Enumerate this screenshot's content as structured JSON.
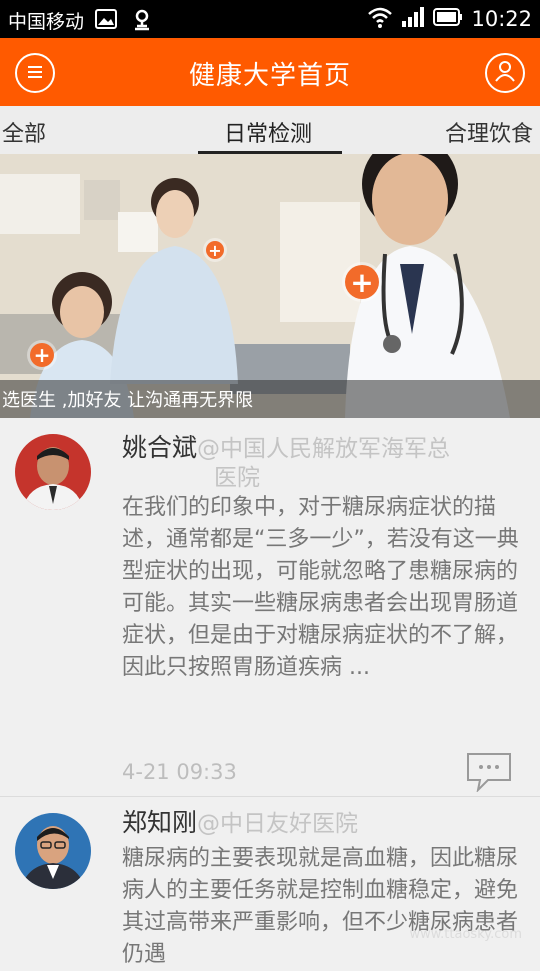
{
  "status_bar": {
    "carrier": "中国移动",
    "time": "10:22",
    "icons": [
      "image-icon",
      "location-pin-icon",
      "wifi-icon",
      "signal-icon",
      "battery-icon"
    ]
  },
  "app_bar": {
    "title": "健康大学首页",
    "left_icon": "menu-icon",
    "right_icon": "user-icon",
    "color": "#ff5a00"
  },
  "tabs": [
    {
      "label": "全部",
      "active": false
    },
    {
      "label": "日常检测",
      "active": true
    },
    {
      "label": "合理饮食",
      "active": false
    }
  ],
  "banner": {
    "caption": "选医生 ,加好友 让沟通再无界限"
  },
  "posts": [
    {
      "name": "姚合斌",
      "hospital_line1": "@中国人民解放军海军总",
      "hospital_line2": "医院",
      "body": "在我们的印象中，对于糖尿病症状的描述，通常都是“三多一少”，若没有这一典型症状的出现，可能就忽略了患糖尿病的可能。其实一些糖尿病患者会出现胃肠道症状，但是由于对糖尿病症状的不了解，因此只按照胃肠道疾病 ...",
      "time": "4-21 09:33"
    },
    {
      "name": "郑知刚",
      "hospital_line1": "@中日友好医院",
      "body": "糖尿病的主要表现就是高血糖，因此糖尿病人的主要任务就是控制血糖稳定，避免其过高带来严重影响，但不少糖尿病患者仍遇"
    }
  ],
  "watermark": "www.ttaosky.com"
}
